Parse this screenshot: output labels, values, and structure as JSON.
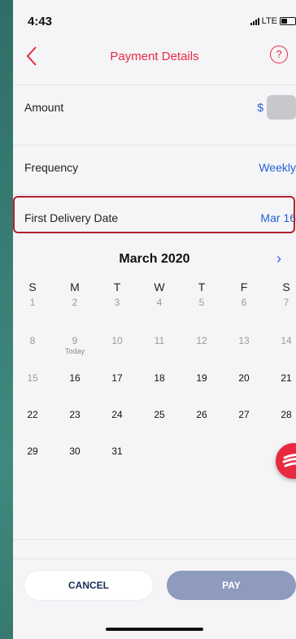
{
  "status": {
    "time": "4:43",
    "network": "LTE"
  },
  "nav": {
    "title": "Payment Details",
    "help": "?"
  },
  "amount": {
    "label": "Amount",
    "value": "$"
  },
  "frequency": {
    "label": "Frequency",
    "value": "Weekly"
  },
  "first_delivery": {
    "label": "First Delivery Date",
    "value": "Mar 16"
  },
  "calendar": {
    "month": "March 2020",
    "next": "›",
    "weekdays": [
      "S",
      "M",
      "T",
      "W",
      "T",
      "F",
      "S"
    ],
    "weeks": [
      [
        "1",
        "2",
        "3",
        "4",
        "5",
        "6",
        "7"
      ],
      [
        "8",
        "9",
        "10",
        "11",
        "12",
        "13",
        "14"
      ],
      [
        "15",
        "16",
        "17",
        "18",
        "19",
        "20",
        "21"
      ],
      [
        "22",
        "23",
        "24",
        "25",
        "26",
        "27",
        "28"
      ],
      [
        "29",
        "30",
        "31",
        "",
        "",
        "",
        ""
      ]
    ],
    "today_label": "Today"
  },
  "buttons": {
    "cancel": "CANCEL",
    "pay": "PAY"
  },
  "colors": {
    "accent": "#e8293f",
    "link": "#2560d6",
    "highlight": "#b3202e",
    "pay": "#8e9bbd"
  }
}
